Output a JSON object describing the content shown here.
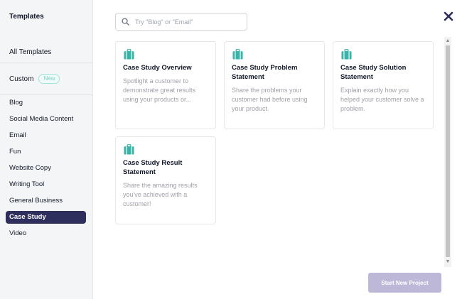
{
  "sidebar": {
    "title": "Templates",
    "all_label": "All Templates",
    "custom_label": "Custom",
    "custom_badge": "New",
    "items": [
      {
        "label": "Blog"
      },
      {
        "label": "Social Media Content"
      },
      {
        "label": "Email"
      },
      {
        "label": "Fun"
      },
      {
        "label": "Website Copy"
      },
      {
        "label": "Writing Tool"
      },
      {
        "label": "General Business"
      },
      {
        "label": "Case Study",
        "active": true
      },
      {
        "label": "Video"
      }
    ]
  },
  "search": {
    "placeholder": "Try \"Blog\" or \"Email\"",
    "value": ""
  },
  "icons": {
    "search": "search-icon",
    "close": "close-icon",
    "card": "briefcase-icon"
  },
  "colors": {
    "accent": "#2f2f5e",
    "card_icon": "#3bb3a8",
    "button_bg": "#bdb8d7"
  },
  "cards": [
    {
      "title": "Case Study Overview",
      "description": "Spotlight a customer to demonstrate great results using your products or..."
    },
    {
      "title": "Case Study Problem Statement",
      "description": "Share the problems your customer had before using your product."
    },
    {
      "title": "Case Study Solution Statement",
      "description": "Explain exactly how you helped your customer solve a problem."
    },
    {
      "title": "Case Study Result Statement",
      "description": "Share the amazing results you've achieved with a customer!"
    }
  ],
  "footer": {
    "start_label": "Start New Project"
  }
}
